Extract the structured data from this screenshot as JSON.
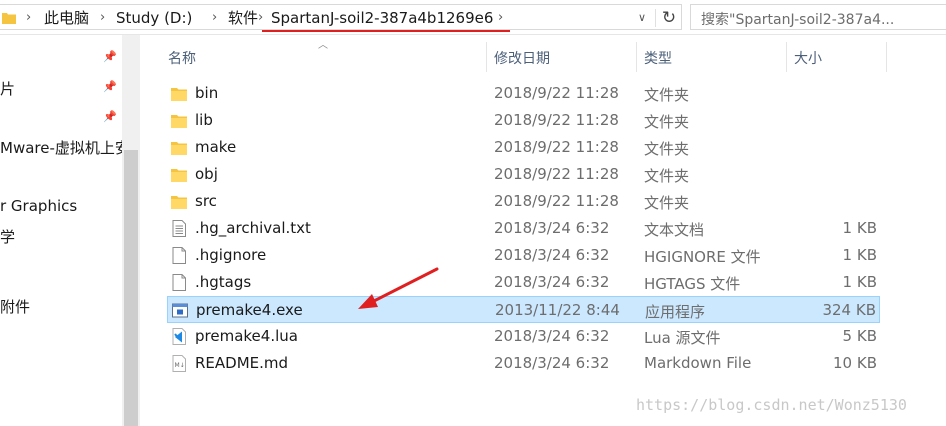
{
  "address": {
    "crumbs": [
      "此电脑",
      "Study (D:)",
      "软件",
      "SpartanJ-soil2-387a4b1269e6"
    ],
    "separator": "›",
    "dropdown": "∨",
    "refresh": "↻"
  },
  "search": {
    "placeholder": "搜索\"SpartanJ-soil2-387a4..."
  },
  "nav": {
    "items": [
      "片",
      "Mware-虚拟机上安",
      "r Graphics",
      "学",
      "附件"
    ]
  },
  "columns": {
    "name": "名称",
    "date": "修改日期",
    "type": "类型",
    "size": "大小"
  },
  "files": [
    {
      "name": "bin",
      "date": "2018/9/22 11:28",
      "type": "文件夹",
      "size": "",
      "icon": "folder-icon"
    },
    {
      "name": "lib",
      "date": "2018/9/22 11:28",
      "type": "文件夹",
      "size": "",
      "icon": "folder-icon"
    },
    {
      "name": "make",
      "date": "2018/9/22 11:28",
      "type": "文件夹",
      "size": "",
      "icon": "folder-icon"
    },
    {
      "name": "obj",
      "date": "2018/9/22 11:28",
      "type": "文件夹",
      "size": "",
      "icon": "folder-icon"
    },
    {
      "name": "src",
      "date": "2018/9/22 11:28",
      "type": "文件夹",
      "size": "",
      "icon": "folder-icon"
    },
    {
      "name": ".hg_archival.txt",
      "date": "2018/3/24 6:32",
      "type": "文本文档",
      "size": "1 KB",
      "icon": "text-file-icon"
    },
    {
      "name": ".hgignore",
      "date": "2018/3/24 6:32",
      "type": "HGIGNORE 文件",
      "size": "1 KB",
      "icon": "blank-file-icon"
    },
    {
      "name": ".hgtags",
      "date": "2018/3/24 6:32",
      "type": "HGTAGS 文件",
      "size": "1 KB",
      "icon": "blank-file-icon"
    },
    {
      "name": "premake4.exe",
      "date": "2013/11/22 8:44",
      "type": "应用程序",
      "size": "324 KB",
      "icon": "exe-icon"
    },
    {
      "name": "premake4.lua",
      "date": "2018/3/24 6:32",
      "type": "Lua 源文件",
      "size": "5 KB",
      "icon": "vscode-file-icon"
    },
    {
      "name": "README.md",
      "date": "2018/3/24 6:32",
      "type": "Markdown File",
      "size": "10 KB",
      "icon": "markdown-file-icon"
    }
  ],
  "watermark": "https://blog.csdn.net/Wonz5130",
  "colors": {
    "selection": "#cce8ff",
    "annotation": "#e02020",
    "folder": "#f5c542"
  }
}
